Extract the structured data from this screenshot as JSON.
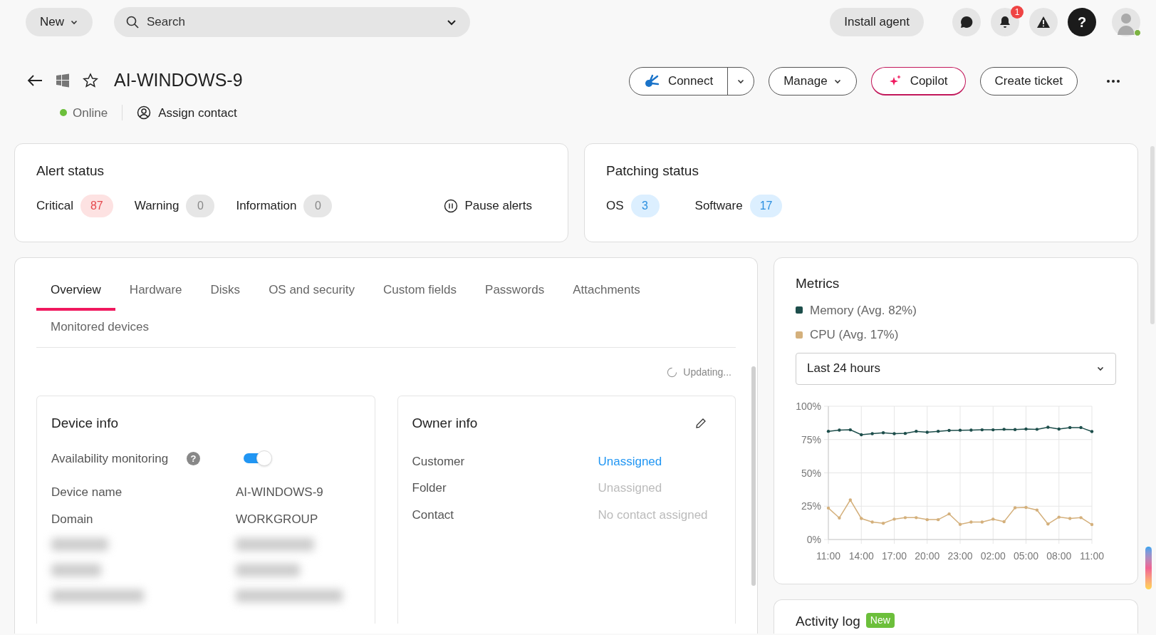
{
  "topbar": {
    "new_button": "New",
    "search": {
      "placeholder": "Search"
    },
    "install_button": "Install agent",
    "notifications_count": "1",
    "help": "?"
  },
  "device": {
    "title": "AI-WINDOWS-9",
    "favorite": false,
    "status": "Online",
    "online": true,
    "assign_contact": "Assign contact"
  },
  "actions": {
    "connect": "Connect",
    "manage": "Manage",
    "copilot": "Copilot",
    "create_ticket": "Create ticket"
  },
  "alert_status": {
    "title": "Alert status",
    "counts": [
      {
        "label": "Critical",
        "value": "87",
        "kind": "critical"
      },
      {
        "label": "Warning",
        "value": "0",
        "kind": "neutral"
      },
      {
        "label": "Information",
        "value": "0",
        "kind": "neutral"
      }
    ],
    "pause": "Pause alerts"
  },
  "patching_status": {
    "title": "Patching status",
    "counts": [
      {
        "label": "OS",
        "value": "3",
        "kind": "info"
      },
      {
        "label": "Software",
        "value": "17",
        "kind": "info"
      }
    ]
  },
  "tabs": [
    {
      "label": "Overview",
      "selected": true
    },
    {
      "label": "Hardware",
      "selected": false
    },
    {
      "label": "Disks",
      "selected": false
    },
    {
      "label": "OS and security",
      "selected": false
    },
    {
      "label": "Custom fields",
      "selected": false
    },
    {
      "label": "Passwords",
      "selected": false
    },
    {
      "label": "Attachments",
      "selected": false
    },
    {
      "label": "Monitored devices",
      "selected": false
    }
  ],
  "updating": "Updating...",
  "device_info": {
    "title": "Device info",
    "availability": {
      "label": "Availability monitoring",
      "help": "?",
      "on": true
    },
    "rows": [
      {
        "label": "Device name",
        "value": "AI-WINDOWS-9"
      },
      {
        "label": "Domain",
        "value": "WORKGROUP"
      }
    ]
  },
  "owner_info": {
    "title": "Owner info",
    "rows": [
      {
        "label": "Customer",
        "value": "Unassigned",
        "kind": "link"
      },
      {
        "label": "Folder",
        "value": "Unassigned",
        "kind": "muted"
      },
      {
        "label": "Contact",
        "value": "No contact assigned",
        "kind": "muted"
      }
    ]
  },
  "metrics": {
    "title": "Metrics",
    "range": "Last 24 hours",
    "chart_data": {
      "type": "line",
      "categories": [
        "11:00",
        null,
        null,
        "14:00",
        null,
        null,
        "17:00",
        null,
        null,
        "20:00",
        null,
        null,
        "23:00",
        null,
        null,
        "02:00",
        null,
        null,
        "05:00",
        null,
        null,
        "08:00",
        null,
        null,
        "11:00"
      ],
      "series": [
        {
          "name": "Memory (Avg. 82%)",
          "color": "#1d4e4b",
          "values": [
            81.2,
            82.1,
            82.3,
            78.6,
            79.4,
            80.1,
            79.4,
            79.6,
            81.2,
            80.5,
            81.2,
            81.8,
            82.0,
            82.1,
            82.3,
            82.3,
            82.7,
            82.5,
            82.9,
            82.7,
            84.2,
            82.9,
            84.0,
            84.0,
            81.0
          ]
        },
        {
          "name": "CPU (Avg. 17%)",
          "color": "#d4b07c",
          "values": [
            23.6,
            16.2,
            29.7,
            15.8,
            13.1,
            12.2,
            15.3,
            16.4,
            16.4,
            14.9,
            14.9,
            19.2,
            11.4,
            13.1,
            13.1,
            15.3,
            13.4,
            23.8,
            24.1,
            22.1,
            11.6,
            16.8,
            15.8,
            16.4,
            11.2
          ]
        }
      ],
      "ylim": [
        0,
        100
      ],
      "grid": true,
      "yticks": [
        {
          "value": 0,
          "label": "0%"
        },
        {
          "value": 25,
          "label": "25%"
        },
        {
          "value": 50,
          "label": "50%"
        },
        {
          "value": 75,
          "label": "75%"
        },
        {
          "value": 100,
          "label": "100%"
        }
      ]
    }
  },
  "activity_log": {
    "title": "Activity log",
    "badge": "New"
  }
}
